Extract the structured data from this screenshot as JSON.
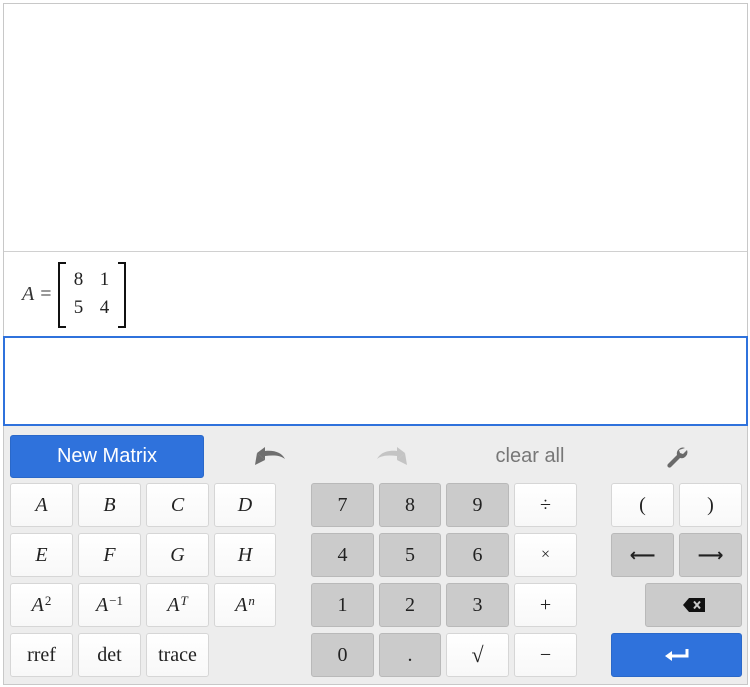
{
  "expression": {
    "variable": "A",
    "equals": "=",
    "matrix": [
      [
        "8",
        "1"
      ],
      [
        "5",
        "4"
      ]
    ]
  },
  "input": {
    "value": ""
  },
  "toolbar": {
    "new_matrix_label": "New Matrix",
    "undo_icon": "undo-icon",
    "redo_icon": "redo-icon",
    "clear_all_label": "clear all",
    "settings_icon": "wrench-icon"
  },
  "keys": {
    "letters": [
      "A",
      "B",
      "C",
      "D",
      "E",
      "F",
      "G",
      "H"
    ],
    "powers": [
      {
        "base": "A",
        "exp": "2"
      },
      {
        "base": "A",
        "exp": "−1"
      },
      {
        "base": "A",
        "exp": "T"
      },
      {
        "base": "A",
        "exp": "n"
      }
    ],
    "functions": [
      "rref",
      "det",
      "trace"
    ],
    "digits": [
      "7",
      "8",
      "9",
      "4",
      "5",
      "6",
      "1",
      "2",
      "3",
      "0",
      "."
    ],
    "operators": {
      "divide": "÷",
      "times": "×",
      "plus": "+",
      "minus": "−",
      "sqrt": "√"
    },
    "parens": {
      "open": "(",
      "close": ")"
    },
    "arrows": {
      "left": "⟵",
      "right": "⟶"
    },
    "backspace_icon": "backspace-icon",
    "enter_icon": "enter-icon"
  },
  "colors": {
    "accent": "#2f72dc",
    "key_gray": "#cbcbcb",
    "keypad_bg": "#ededed"
  }
}
